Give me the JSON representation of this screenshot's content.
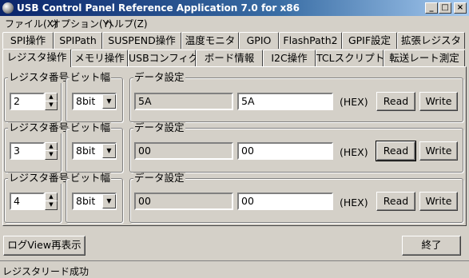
{
  "window": {
    "title": "USB Control Panel Reference Application 7.0 for x86",
    "controls": {
      "minimize": "_",
      "maximize": "□",
      "close": "×"
    }
  },
  "menu": [
    "ファイル(X)",
    "オプション(Y)",
    "ヘルプ(Z)"
  ],
  "tabs_row1": [
    "SPI操作",
    "SPIPath",
    "SUSPEND操作",
    "温度モニタ",
    "GPIO",
    "FlashPath2",
    "GPIF設定",
    "拡張レジスタ"
  ],
  "tabs_row2": [
    "レジスタ操作",
    "メモリ操作",
    "USBコンフィグ",
    "ボード情報",
    "I2C操作",
    "TCLスクリプト",
    "転送レート測定"
  ],
  "active_tab": "レジスタ操作",
  "rows": [
    {
      "reg_label": "レジスタ番号",
      "reg_value": "2",
      "width_label": "ビット幅",
      "width_value": "8bit",
      "data_label": "データ設定",
      "current": "5A",
      "input": "5A",
      "hex": "(HEX)",
      "read": "Read",
      "write": "Write"
    },
    {
      "reg_label": "レジスタ番号",
      "reg_value": "3",
      "width_label": "ビット幅",
      "width_value": "8bit",
      "data_label": "データ設定",
      "current": "00",
      "input": "00",
      "hex": "(HEX)",
      "read": "Read",
      "write": "Write"
    },
    {
      "reg_label": "レジスタ番号",
      "reg_value": "4",
      "width_label": "ビット幅",
      "width_value": "8bit",
      "data_label": "データ設定",
      "current": "00",
      "input": "00",
      "hex": "(HEX)",
      "read": "Read",
      "write": "Write"
    }
  ],
  "footer": {
    "log_button": "ログView再表示",
    "exit_button": "終了"
  },
  "status": "レジスタリード成功"
}
